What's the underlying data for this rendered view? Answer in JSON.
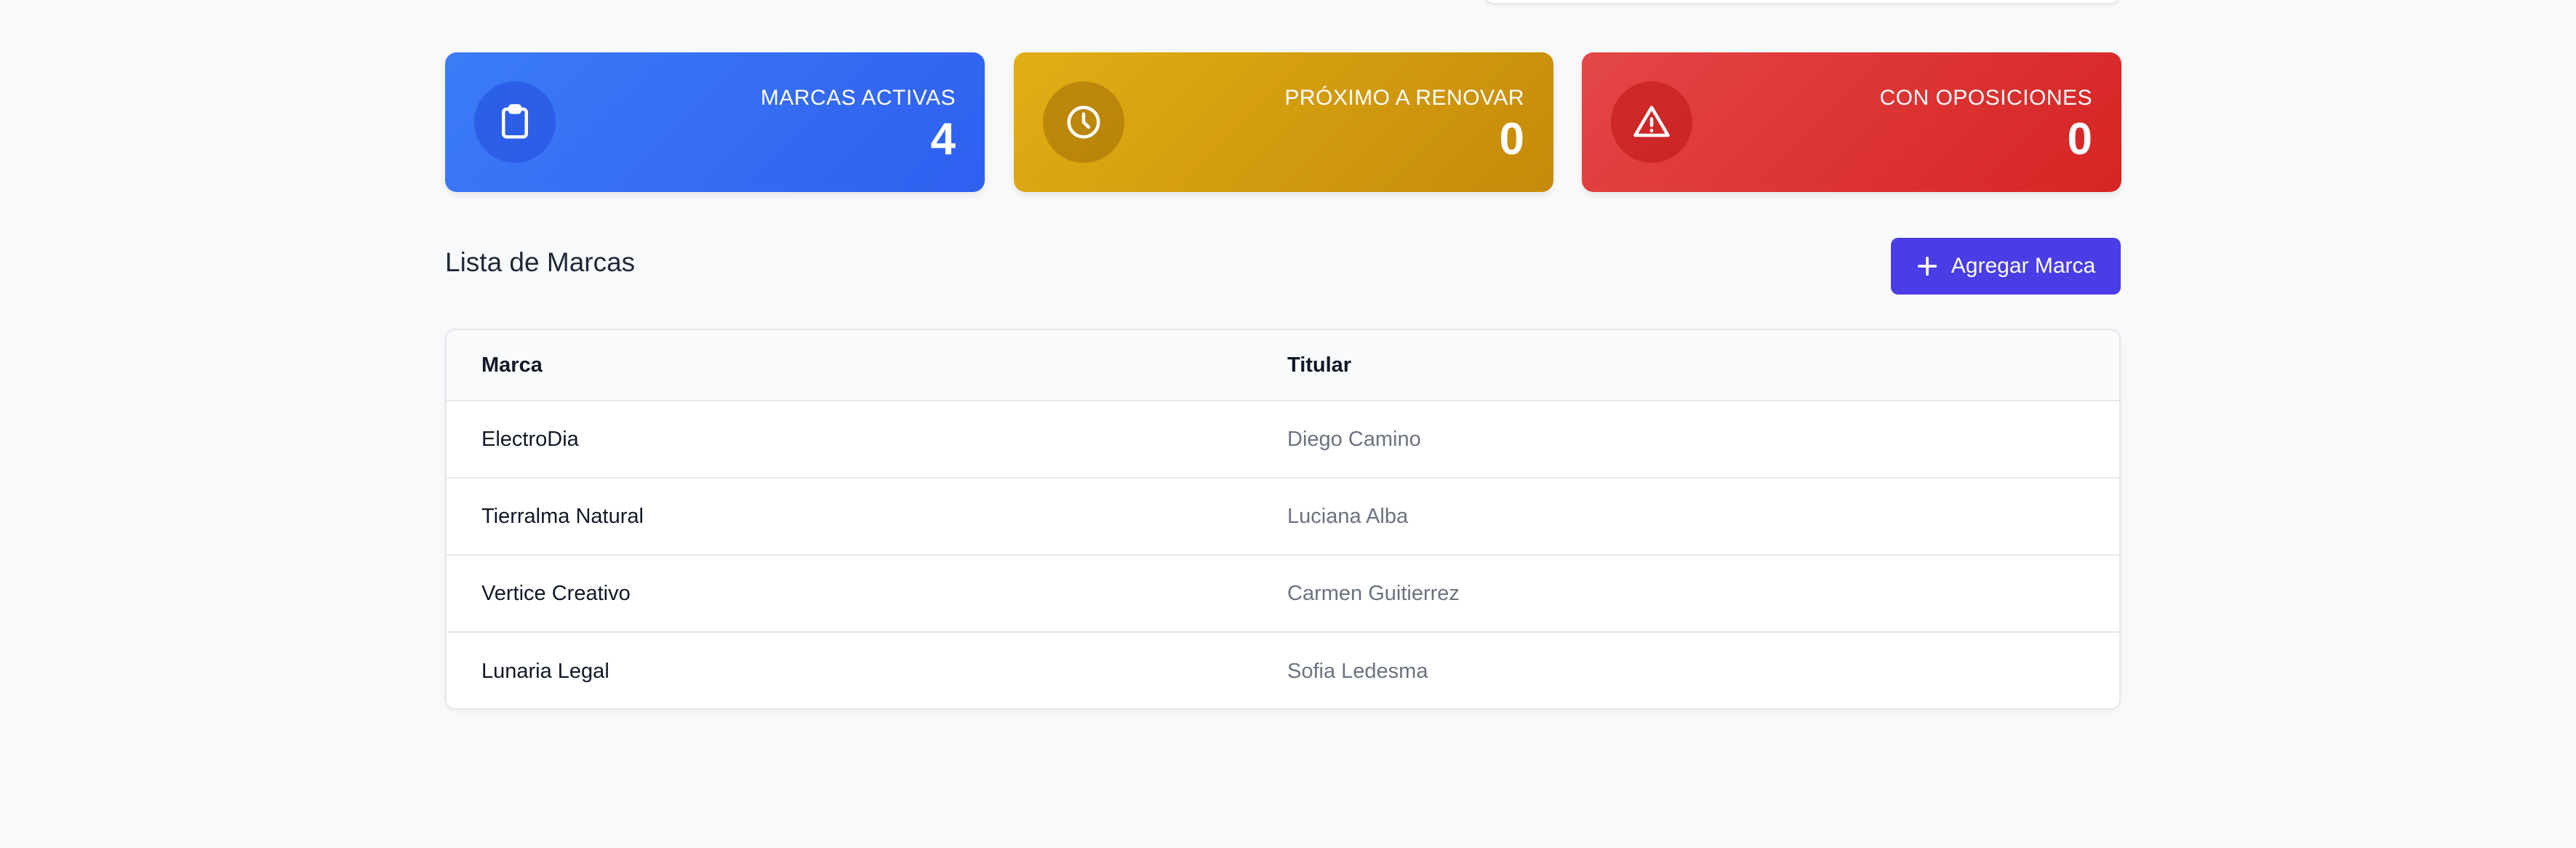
{
  "stats": [
    {
      "label": "MARCAS ACTIVAS",
      "value": "4",
      "icon": "clipboard-icon"
    },
    {
      "label": "PRÓXIMO A RENOVAR",
      "value": "0",
      "icon": "clock-icon"
    },
    {
      "label": "CON OPOSICIONES",
      "value": "0",
      "icon": "warning-triangle-icon"
    }
  ],
  "list": {
    "title": "Lista de Marcas",
    "add_button": {
      "label": "Agregar Marca",
      "icon": "plus-icon"
    }
  },
  "table": {
    "headers": [
      "Marca",
      "Titular"
    ],
    "rows": [
      [
        "ElectroDia",
        "Diego Camino"
      ],
      [
        "Tierralma Natural",
        "Luciana Alba"
      ],
      [
        "Vertice Creativo",
        "Carmen Guitierrez"
      ],
      [
        "Lunaria Legal",
        "Sofia Ledesma"
      ]
    ]
  },
  "colors": {
    "blue_card": "#3b7cf6",
    "yellow_card": "#e2ae14",
    "red_card": "#e44646",
    "primary_button": "#4a3de6"
  }
}
